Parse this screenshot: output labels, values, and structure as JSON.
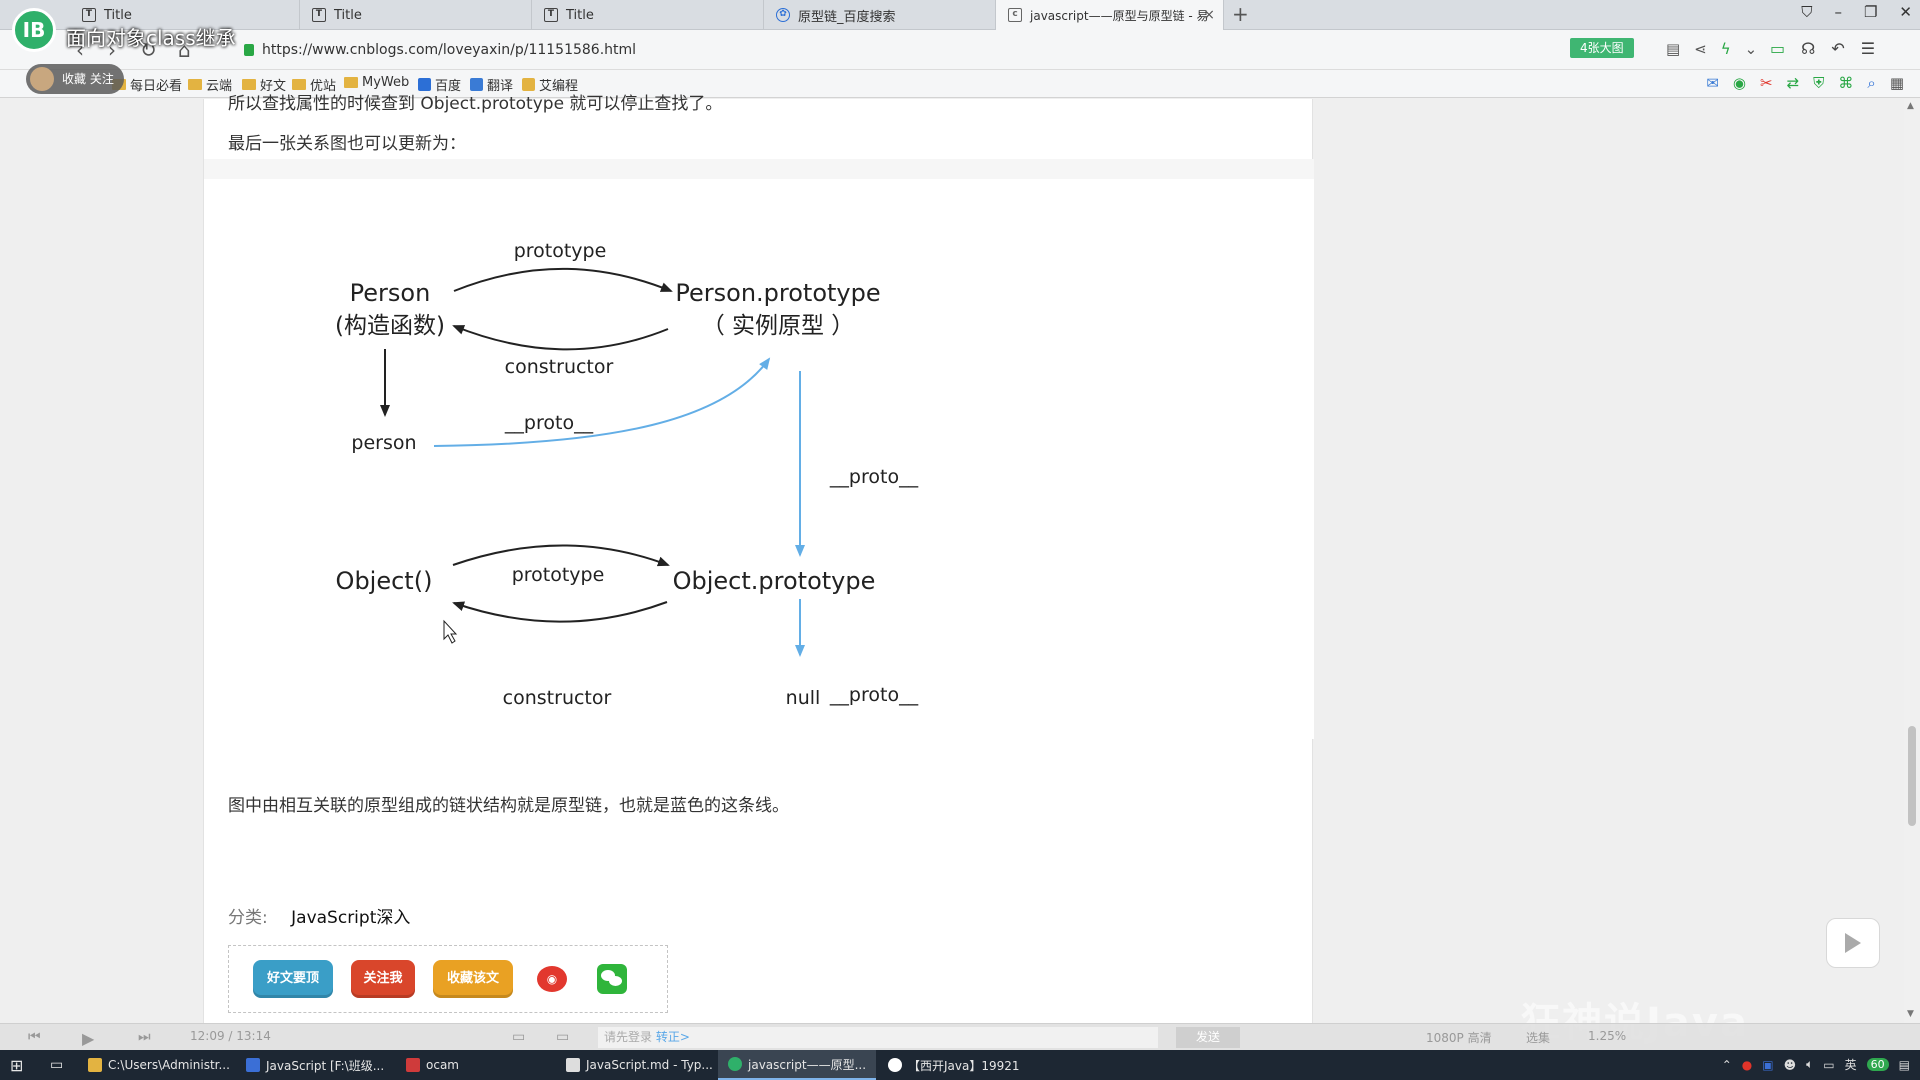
{
  "overlay": {
    "logo_text": "IB",
    "video_title": "面向对象class继承",
    "follow_label": "收藏",
    "follow_extra": "关注"
  },
  "tabs": [
    {
      "label": "Title",
      "icon": "typora-icon"
    },
    {
      "label": "Title",
      "icon": "typora-icon"
    },
    {
      "label": "Title",
      "icon": "typora-icon"
    },
    {
      "label": "原型链_百度搜索",
      "icon": "baidu-paw-icon"
    },
    {
      "label": "javascript——原型与原型链 - 易",
      "icon": "cnblogs-icon"
    }
  ],
  "address": {
    "url": "https://www.cnblogs.com/loveyaxin/p/11151586.html",
    "big_image_button": "4张大图"
  },
  "bookmarks": [
    {
      "label": "每日必看",
      "type": "folder"
    },
    {
      "label": "云端",
      "type": "folder"
    },
    {
      "label": "好文",
      "type": "folder"
    },
    {
      "label": "优站",
      "type": "folder"
    },
    {
      "label": "MyWeb",
      "type": "folder"
    },
    {
      "label": "百度",
      "type": "site"
    },
    {
      "label": "翻译",
      "type": "site"
    },
    {
      "label": "艾编程",
      "type": "site"
    }
  ],
  "article": {
    "cut_line": "所以查找属性的时候查到 Object.prototype 就可以停止查找了。",
    "intro": "最后一张关系图也可以更新为：",
    "conclusion": "图中由相互关联的原型组成的链状结构就是原型链，也就是蓝色的这条线。",
    "category_key": "分类:",
    "category_value": "JavaScript深入"
  },
  "diagram": {
    "person": "Person",
    "person_sub": "(构造函数)",
    "person_prototype": "Person.prototype",
    "person_prototype_sub": "（ 实例原型 ）",
    "prototype_top": "prototype",
    "constructor_top": "constructor",
    "instance": "person",
    "proto_instance": "__proto__",
    "proto_chain": "__proto__",
    "object_ctor": "Object()",
    "object_prototype": "Object.prototype",
    "prototype_bottom": "prototype",
    "constructor_bottom": "constructor",
    "proto_null": "__proto__",
    "null": "null",
    "colors": {
      "black": "#222222",
      "blue": "#63aee6"
    }
  },
  "share": {
    "recommend": "好文要顶",
    "follow_me": "关注我",
    "collect": "收藏该文",
    "weibo_icon": "weibo-icon",
    "wechat_icon": "wechat-icon"
  },
  "player": {
    "time": "12:09 / 13:14",
    "danmu_placeholder": "请先登录",
    "danmu_link": "转正>",
    "send": "发送",
    "quality": "1080P 高清",
    "select": "选集",
    "speed": "1.25%"
  },
  "watermark": "狂神说Java",
  "taskbar": [
    {
      "label": "C:\\Users\\Administr...",
      "color": "#e3b341"
    },
    {
      "label": "JavaScript [F:\\班级...",
      "color": "#3b6fd6"
    },
    {
      "label": "ocam",
      "color": "#cf3b3b"
    },
    {
      "label": "JavaScript.md - Typ...",
      "color": "#dddddd"
    },
    {
      "label": "javascript——原型...",
      "color": "#2fb06a"
    },
    {
      "label": "【西开Java】19921",
      "color": "#ffffff"
    }
  ],
  "tray": {
    "badge": "60",
    "ime": "英"
  }
}
